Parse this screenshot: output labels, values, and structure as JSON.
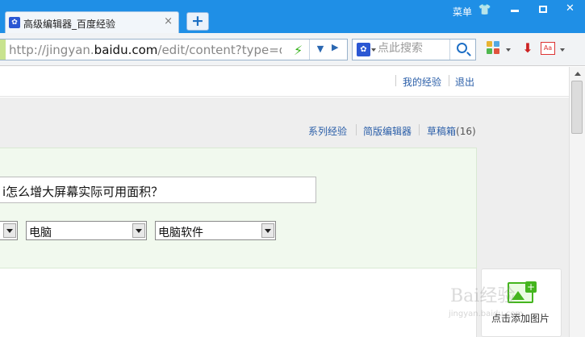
{
  "browser": {
    "tab_title": "高级编辑器_百度经验",
    "tab_close": "×",
    "new_tab": "+",
    "menu_label": "菜单",
    "favicon": "baidu-paw-icon",
    "url_prefix": "http://jingyan.",
    "url_domain": "baidu.com",
    "url_rest": "/edit/content?type=dr",
    "search_placeholder": "点此搜索",
    "search_engine_icon": "baidu-paw-icon"
  },
  "header": {
    "links": [
      "我的经验",
      "退出"
    ]
  },
  "subnav": {
    "series_label": "系列经验",
    "simple_editor_label": "简版编辑器",
    "drafts_label": "草稿箱",
    "drafts_count": "(16)"
  },
  "form": {
    "title_value": "i怎么增大屏幕实际可用面积？",
    "category_1": "",
    "category_2": "电脑",
    "category_3": "电脑软件"
  },
  "image_panel": {
    "add_image_label": "点击添加图片"
  },
  "watermark": {
    "text": "Bai经验",
    "sub": "jingyan.baidu.com"
  },
  "colors": {
    "titlebar": "#1f8fe6",
    "link": "#2a5ea8",
    "panel_bg": "#f1f9ee",
    "accent_green": "#44b51e"
  }
}
